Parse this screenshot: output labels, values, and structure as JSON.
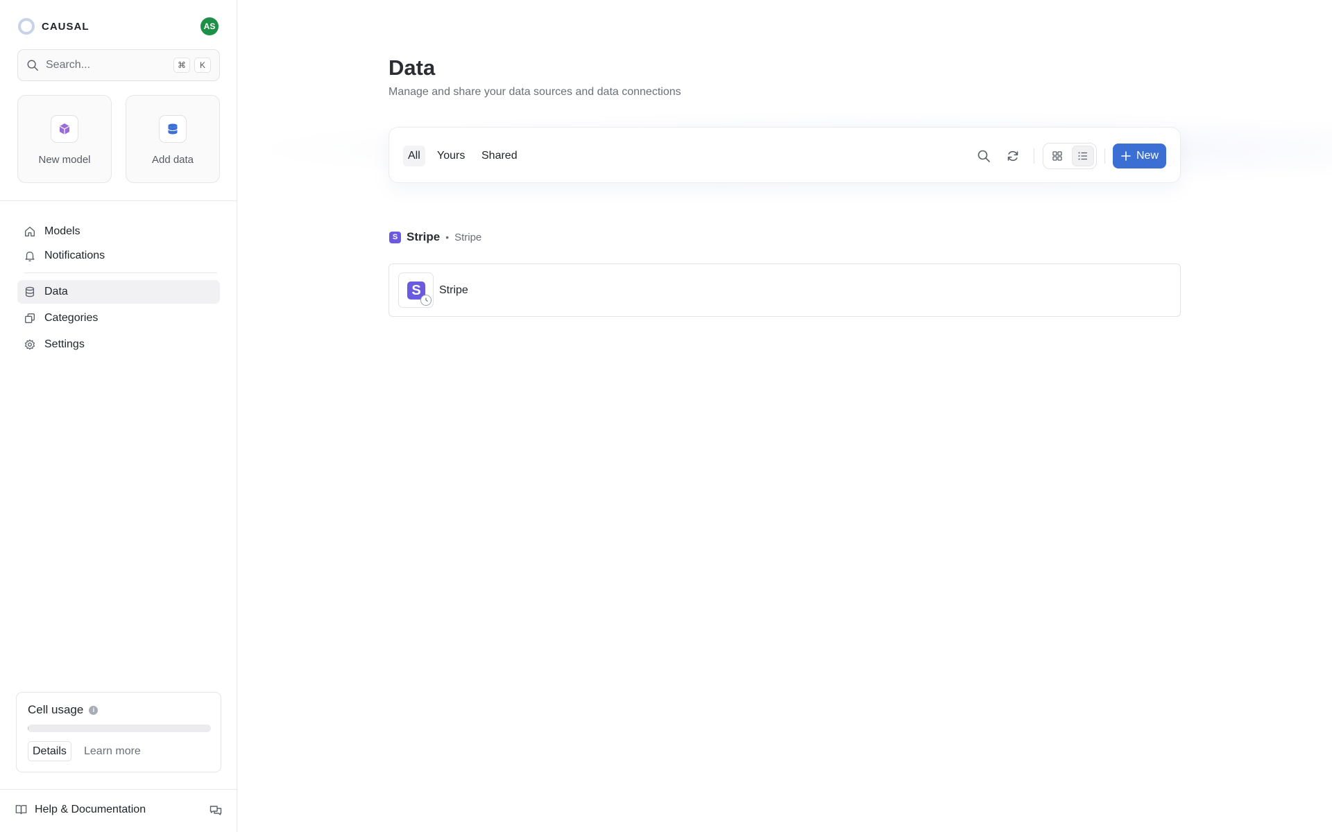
{
  "brand": {
    "name": "CAUSAL"
  },
  "user": {
    "initials": "AS",
    "avatar_color": "#1d8f47"
  },
  "search": {
    "placeholder": "Search...",
    "shortcut_key1": "⌘",
    "shortcut_key2": "K"
  },
  "quick_actions": [
    {
      "label": "New model",
      "icon": "cube-icon"
    },
    {
      "label": "Add data",
      "icon": "database-icon"
    }
  ],
  "nav": {
    "items": [
      {
        "label": "Models",
        "icon": "home-icon"
      },
      {
        "label": "Notifications",
        "icon": "bell-icon"
      },
      {
        "label": "Data",
        "icon": "database-icon",
        "active": true
      },
      {
        "label": "Categories",
        "icon": "copy-icon"
      },
      {
        "label": "Settings",
        "icon": "gear-icon"
      }
    ]
  },
  "usage": {
    "title": "Cell usage",
    "percent": 0.5,
    "details_label": "Details",
    "learn_more_label": "Learn more"
  },
  "footer": {
    "help_label": "Help & Documentation"
  },
  "page": {
    "title": "Data",
    "subtitle": "Manage and share your data sources and data connections"
  },
  "toolbar": {
    "tabs": [
      {
        "label": "All",
        "active": true
      },
      {
        "label": "Yours"
      },
      {
        "label": "Shared"
      }
    ],
    "new_label": "New",
    "accent": "#3b6fd4"
  },
  "group": {
    "badge": "S",
    "name": "Stripe",
    "separator": "•",
    "sub": "Stripe",
    "items": [
      {
        "badge": "S",
        "name": "Stripe"
      }
    ],
    "brand_color": "#6a5ae0"
  }
}
